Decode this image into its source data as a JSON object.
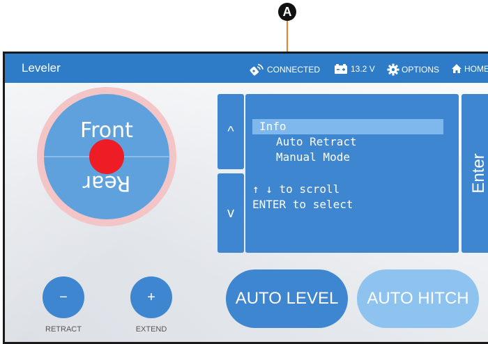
{
  "callout": {
    "letter": "A"
  },
  "topbar": {
    "title": "Leveler",
    "connection_status": "CONNECTED",
    "battery_voltage": "13.2 V",
    "options_label": "OPTIONS",
    "home_label": "HOME"
  },
  "joystick": {
    "front_label": "Front",
    "rear_label": "Rear"
  },
  "menu": {
    "items": [
      "Info",
      "Auto Retract",
      "Manual Mode"
    ],
    "selected_index": 0,
    "help_scroll": "↑ ↓ to scroll",
    "help_select": "ENTER to select"
  },
  "nav": {
    "up_label": "^",
    "down_label": "v",
    "enter_label": "Enter"
  },
  "controls": {
    "retract_symbol": "−",
    "retract_label": "RETRACT",
    "extend_symbol": "+",
    "extend_label": "EXTEND"
  },
  "actions": {
    "auto_level_label": "AUTO LEVEL",
    "auto_hitch_label": "AUTO HITCH"
  },
  "colors": {
    "topbar": "#2e7cc7",
    "button": "#3e86cf",
    "button_disabled": "#7fb8ec",
    "level_dot": "#ee1c24",
    "callout_line": "#e8822a"
  }
}
